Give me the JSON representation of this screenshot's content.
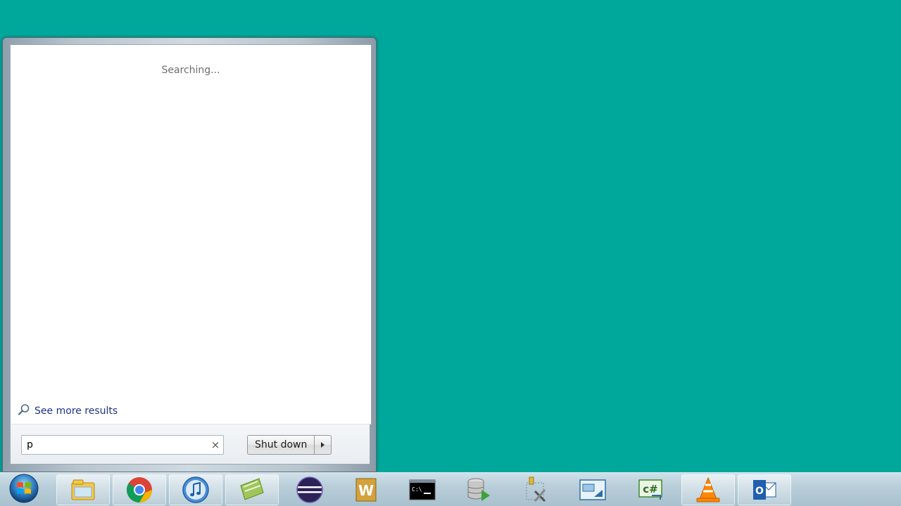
{
  "start_menu": {
    "status_text": "Searching...",
    "see_more_label": "See more results",
    "search": {
      "value": "p",
      "clear_glyph": "×"
    },
    "shutdown_label": "Shut down"
  },
  "taskbar": {
    "start_button": "windows-orb-icon",
    "pinned": [
      "file-explorer-icon",
      "chrome-icon",
      "itunes-icon",
      "green-app-icon",
      "eclipse-icon",
      "word-icon",
      "command-prompt-icon",
      "database-icon",
      "tools-icon",
      "screen-app-icon",
      "csharp-icon",
      "vlc-icon",
      "outlook-icon"
    ]
  },
  "colors": {
    "desktop": "#00a89c",
    "link": "#1e3287",
    "taskbar": "#b9ced9"
  }
}
